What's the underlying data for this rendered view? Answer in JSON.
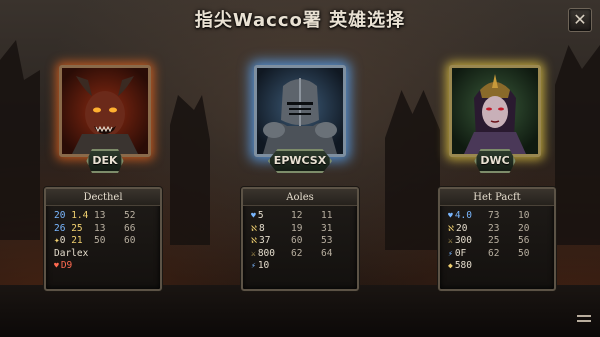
{
  "title": "指尖Wacco署 英雄选择",
  "close_label": "✕",
  "heroes": [
    {
      "badge": "DEK",
      "panel_title": "Decthel",
      "rows": [
        {
          "a": "20",
          "b": "1.4",
          "c": "13",
          "d": "52"
        },
        {
          "a": "26",
          "b": "25",
          "c": "13",
          "d": "66"
        },
        {
          "a": "0",
          "b": "21",
          "c": "50",
          "d": "60"
        }
      ],
      "extra1": "Darlex",
      "extra2": "D9"
    },
    {
      "badge": "EPWCSX",
      "panel_title": "Aoles",
      "rows": [
        {
          "a": "5",
          "c": "12",
          "d": "11"
        },
        {
          "a": "8",
          "c": "19",
          "d": "31"
        },
        {
          "a": "37",
          "c": "60",
          "d": "53"
        },
        {
          "a": "800",
          "c": "62",
          "d": "64"
        },
        {
          "a": "10",
          "c": "",
          "d": ""
        }
      ]
    },
    {
      "badge": "DWC",
      "panel_title": "Het Pacft",
      "rows": [
        {
          "a": "4.0",
          "c": "73",
          "d": "10"
        },
        {
          "a": "20",
          "c": "23",
          "d": "20"
        },
        {
          "a": "300",
          "c": "25",
          "d": "56"
        },
        {
          "a": "0F",
          "c": "62",
          "d": "50"
        },
        {
          "a": "580",
          "c": "",
          "d": ""
        }
      ]
    }
  ],
  "colors": {
    "red_glow": "#ff6e1e",
    "blue_glow": "#5aaaff",
    "gold_glow": "#f0d246"
  },
  "icons": [
    "close-icon",
    "menu-icon",
    "heart-icon",
    "sword-icon",
    "lightning-icon",
    "shield-icon"
  ]
}
